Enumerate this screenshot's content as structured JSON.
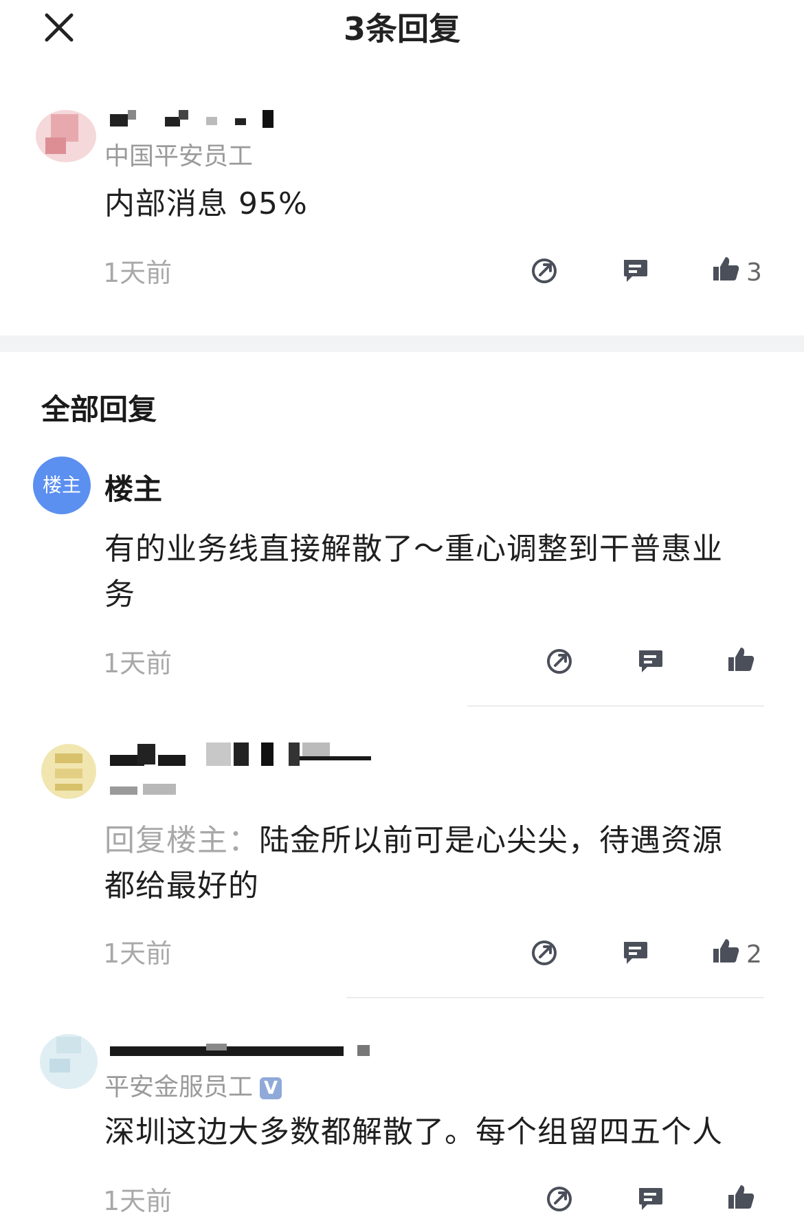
{
  "header": {
    "title": "3条回复"
  },
  "main_comment": {
    "subtitle": "中国平安员工",
    "text": "内部消息 95%",
    "time": "1天前",
    "likes": "3"
  },
  "section": {
    "title": "全部回复"
  },
  "replies": [
    {
      "avatar_label": "楼主",
      "author": "楼主",
      "text_line1": "有的业务线直接解散了～重心调整到干普惠业",
      "text_line2": "务",
      "time": "1天前",
      "likes": ""
    },
    {
      "reply_prefix": "回复楼主：",
      "text_line1_rest": "陆金所以前可是心尖尖，待遇资源",
      "text_line2": "都给最好的",
      "time": "1天前",
      "likes": "2"
    },
    {
      "subtitle": "平安金服员工",
      "verified_mark": "V",
      "text": "深圳这边大多数都解散了。每个组留四五个人",
      "time": "1天前",
      "likes": ""
    }
  ],
  "colors": {
    "op_avatar": "#5b8ff0",
    "divider": "#f2f3f5",
    "muted_text": "#a8a8a8"
  },
  "icons": [
    "close-icon",
    "share-icon",
    "comment-icon",
    "like-icon"
  ]
}
